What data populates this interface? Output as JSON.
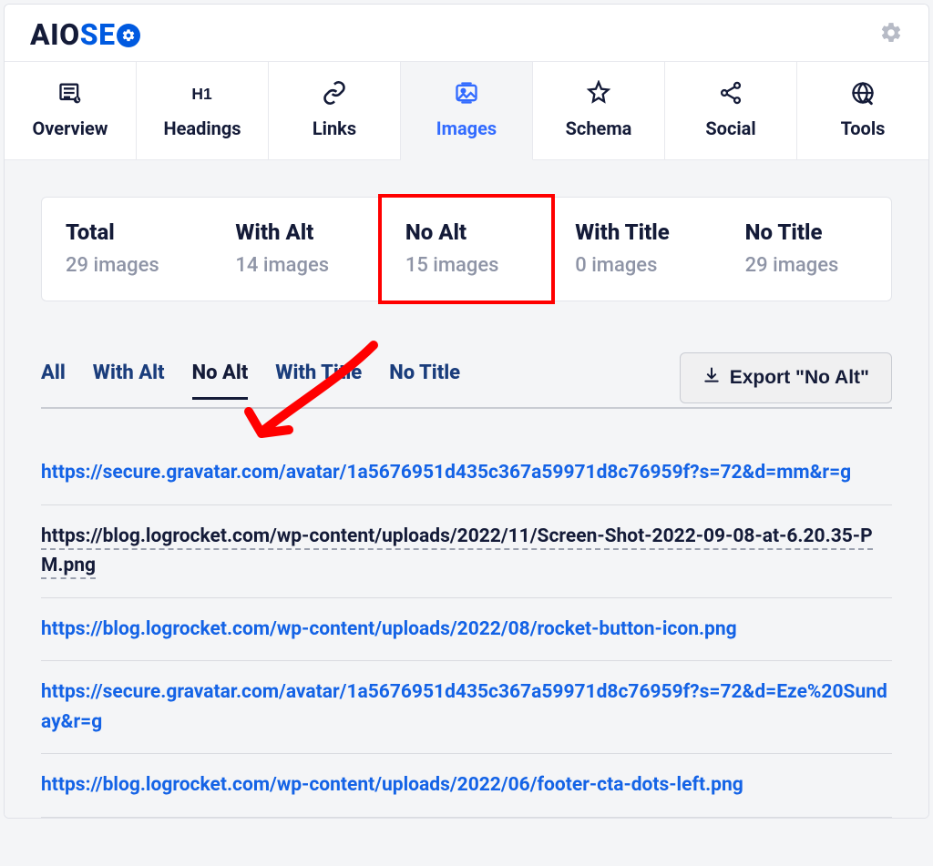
{
  "logo": {
    "part1": "AIO",
    "part2": "SE"
  },
  "nav": [
    {
      "key": "overview",
      "label": "Overview",
      "active": false
    },
    {
      "key": "headings",
      "label": "Headings",
      "active": false
    },
    {
      "key": "links",
      "label": "Links",
      "active": false
    },
    {
      "key": "images",
      "label": "Images",
      "active": true
    },
    {
      "key": "schema",
      "label": "Schema",
      "active": false
    },
    {
      "key": "social",
      "label": "Social",
      "active": false
    },
    {
      "key": "tools",
      "label": "Tools",
      "active": false
    }
  ],
  "stats": [
    {
      "key": "total",
      "title": "Total",
      "sub": "29 images"
    },
    {
      "key": "with-alt",
      "title": "With Alt",
      "sub": "14 images"
    },
    {
      "key": "no-alt",
      "title": "No Alt",
      "sub": "15 images",
      "highlighted": true
    },
    {
      "key": "with-title",
      "title": "With Title",
      "sub": "0 images"
    },
    {
      "key": "no-title",
      "title": "No Title",
      "sub": "29 images"
    }
  ],
  "filters": [
    {
      "key": "all",
      "label": "All",
      "active": false
    },
    {
      "key": "with-alt",
      "label": "With Alt",
      "active": false
    },
    {
      "key": "no-alt",
      "label": "No Alt",
      "active": true
    },
    {
      "key": "with-title",
      "label": "With Title",
      "active": false
    },
    {
      "key": "no-title",
      "label": "No Title",
      "active": false
    }
  ],
  "export_label": "Export \"No Alt\"",
  "urls": [
    {
      "text": "https://secure.gravatar.com/avatar/1a5676951d435c367a59971d8c76959f?s=72&d=mm&r=g",
      "dashed": false
    },
    {
      "text": "https://blog.logrocket.com/wp-content/uploads/2022/11/Screen-Shot-2022-09-08-at-6.20.35-PM.png",
      "dashed": true
    },
    {
      "text": "https://blog.logrocket.com/wp-content/uploads/2022/08/rocket-button-icon.png",
      "dashed": false
    },
    {
      "text": "https://secure.gravatar.com/avatar/1a5676951d435c367a59971d8c76959f?s=72&d=Eze%20Sunday&r=g",
      "dashed": false
    },
    {
      "text": "https://blog.logrocket.com/wp-content/uploads/2022/06/footer-cta-dots-left.png",
      "dashed": false
    }
  ]
}
